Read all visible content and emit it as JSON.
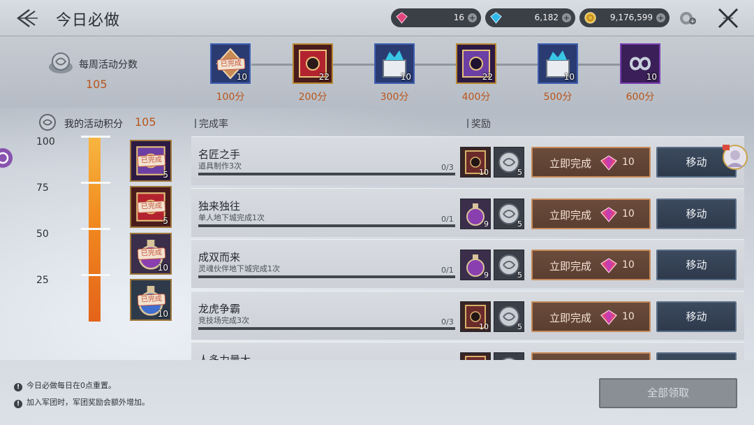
{
  "header": {
    "title": "今日必做",
    "currencies": [
      {
        "name": "red-gem",
        "value": "16",
        "color": "#e0457b"
      },
      {
        "name": "blue-gem",
        "value": "6,182",
        "color": "#2fb7e8"
      },
      {
        "name": "gold-coin",
        "value": "9,176,599",
        "color": "#e3b33c"
      }
    ]
  },
  "weekly": {
    "label": "每周活动分数",
    "score": "105",
    "rewards": [
      {
        "points": "100分",
        "qty": "10",
        "done": true,
        "done_label": "已完成",
        "icon": "coin-chest-icon",
        "frame": "#3f5fb0"
      },
      {
        "points": "200分",
        "qty": "22",
        "done": false,
        "icon": "red-card-icon",
        "frame": "#b8872f"
      },
      {
        "points": "300分",
        "qty": "10",
        "done": false,
        "icon": "crystal-box-icon",
        "frame": "#3f5fb0"
      },
      {
        "points": "400分",
        "qty": "22",
        "done": false,
        "icon": "purple-card-icon",
        "frame": "#b8872f"
      },
      {
        "points": "500分",
        "qty": "10",
        "done": false,
        "icon": "crystal-box-icon",
        "frame": "#3f5fb0"
      },
      {
        "points": "600分",
        "qty": "10",
        "done": false,
        "icon": "infinity-icon",
        "frame": "#7a3fb0"
      }
    ]
  },
  "progress": {
    "label": "我的活动积分",
    "value": "105",
    "fill_fraction": 1.0,
    "scale": [
      "100",
      "75",
      "50",
      "25"
    ],
    "side_rewards": [
      {
        "qty": "5",
        "done_label": "已完成",
        "icon": "purple-card-icon"
      },
      {
        "qty": "5",
        "done_label": "已完成",
        "icon": "red-card-icon"
      },
      {
        "qty": "10",
        "done_label": "已完成",
        "icon": "potion-icon"
      },
      {
        "qty": "10",
        "done_label": "已完成",
        "icon": "potion-blue-icon"
      }
    ]
  },
  "columns": {
    "completion": "完成率",
    "reward": "奖励"
  },
  "tasks": [
    {
      "name": "名匠之手",
      "desc": "道具制作3次",
      "count": "0/3",
      "progress": 0,
      "item_qty": "10",
      "coin_qty": "5",
      "item_icon": "card-icon",
      "instant_label": "立即完成",
      "cost": "10",
      "move_label": "移动"
    },
    {
      "name": "独来独往",
      "desc": "单人地下城完成1次",
      "count": "0/1",
      "progress": 0,
      "item_qty": "9",
      "coin_qty": "5",
      "item_icon": "potion-icon",
      "instant_label": "立即完成",
      "cost": "10",
      "move_label": "移动"
    },
    {
      "name": "成双而来",
      "desc": "灵魂伙伴地下城完成1次",
      "count": "0/1",
      "progress": 0,
      "item_qty": "9",
      "coin_qty": "5",
      "item_icon": "potion-icon",
      "instant_label": "立即完成",
      "cost": "10",
      "move_label": "移动"
    },
    {
      "name": "龙虎争霸",
      "desc": "竞技场完成3次",
      "count": "0/3",
      "progress": 0,
      "item_qty": "10",
      "coin_qty": "5",
      "item_icon": "card-icon",
      "instant_label": "立即完成",
      "cost": "10",
      "move_label": "移动"
    },
    {
      "name": "人多力量大",
      "desc": "",
      "count": "",
      "progress": 0,
      "item_qty": "",
      "coin_qty": "",
      "item_icon": "card-icon",
      "instant_label": "",
      "cost": "",
      "move_label": ""
    }
  ],
  "footer": {
    "notes": [
      "今日必做每日在0点重置。",
      "加入军团时，军团奖励会额外增加。"
    ],
    "claim_all": "全部领取"
  }
}
